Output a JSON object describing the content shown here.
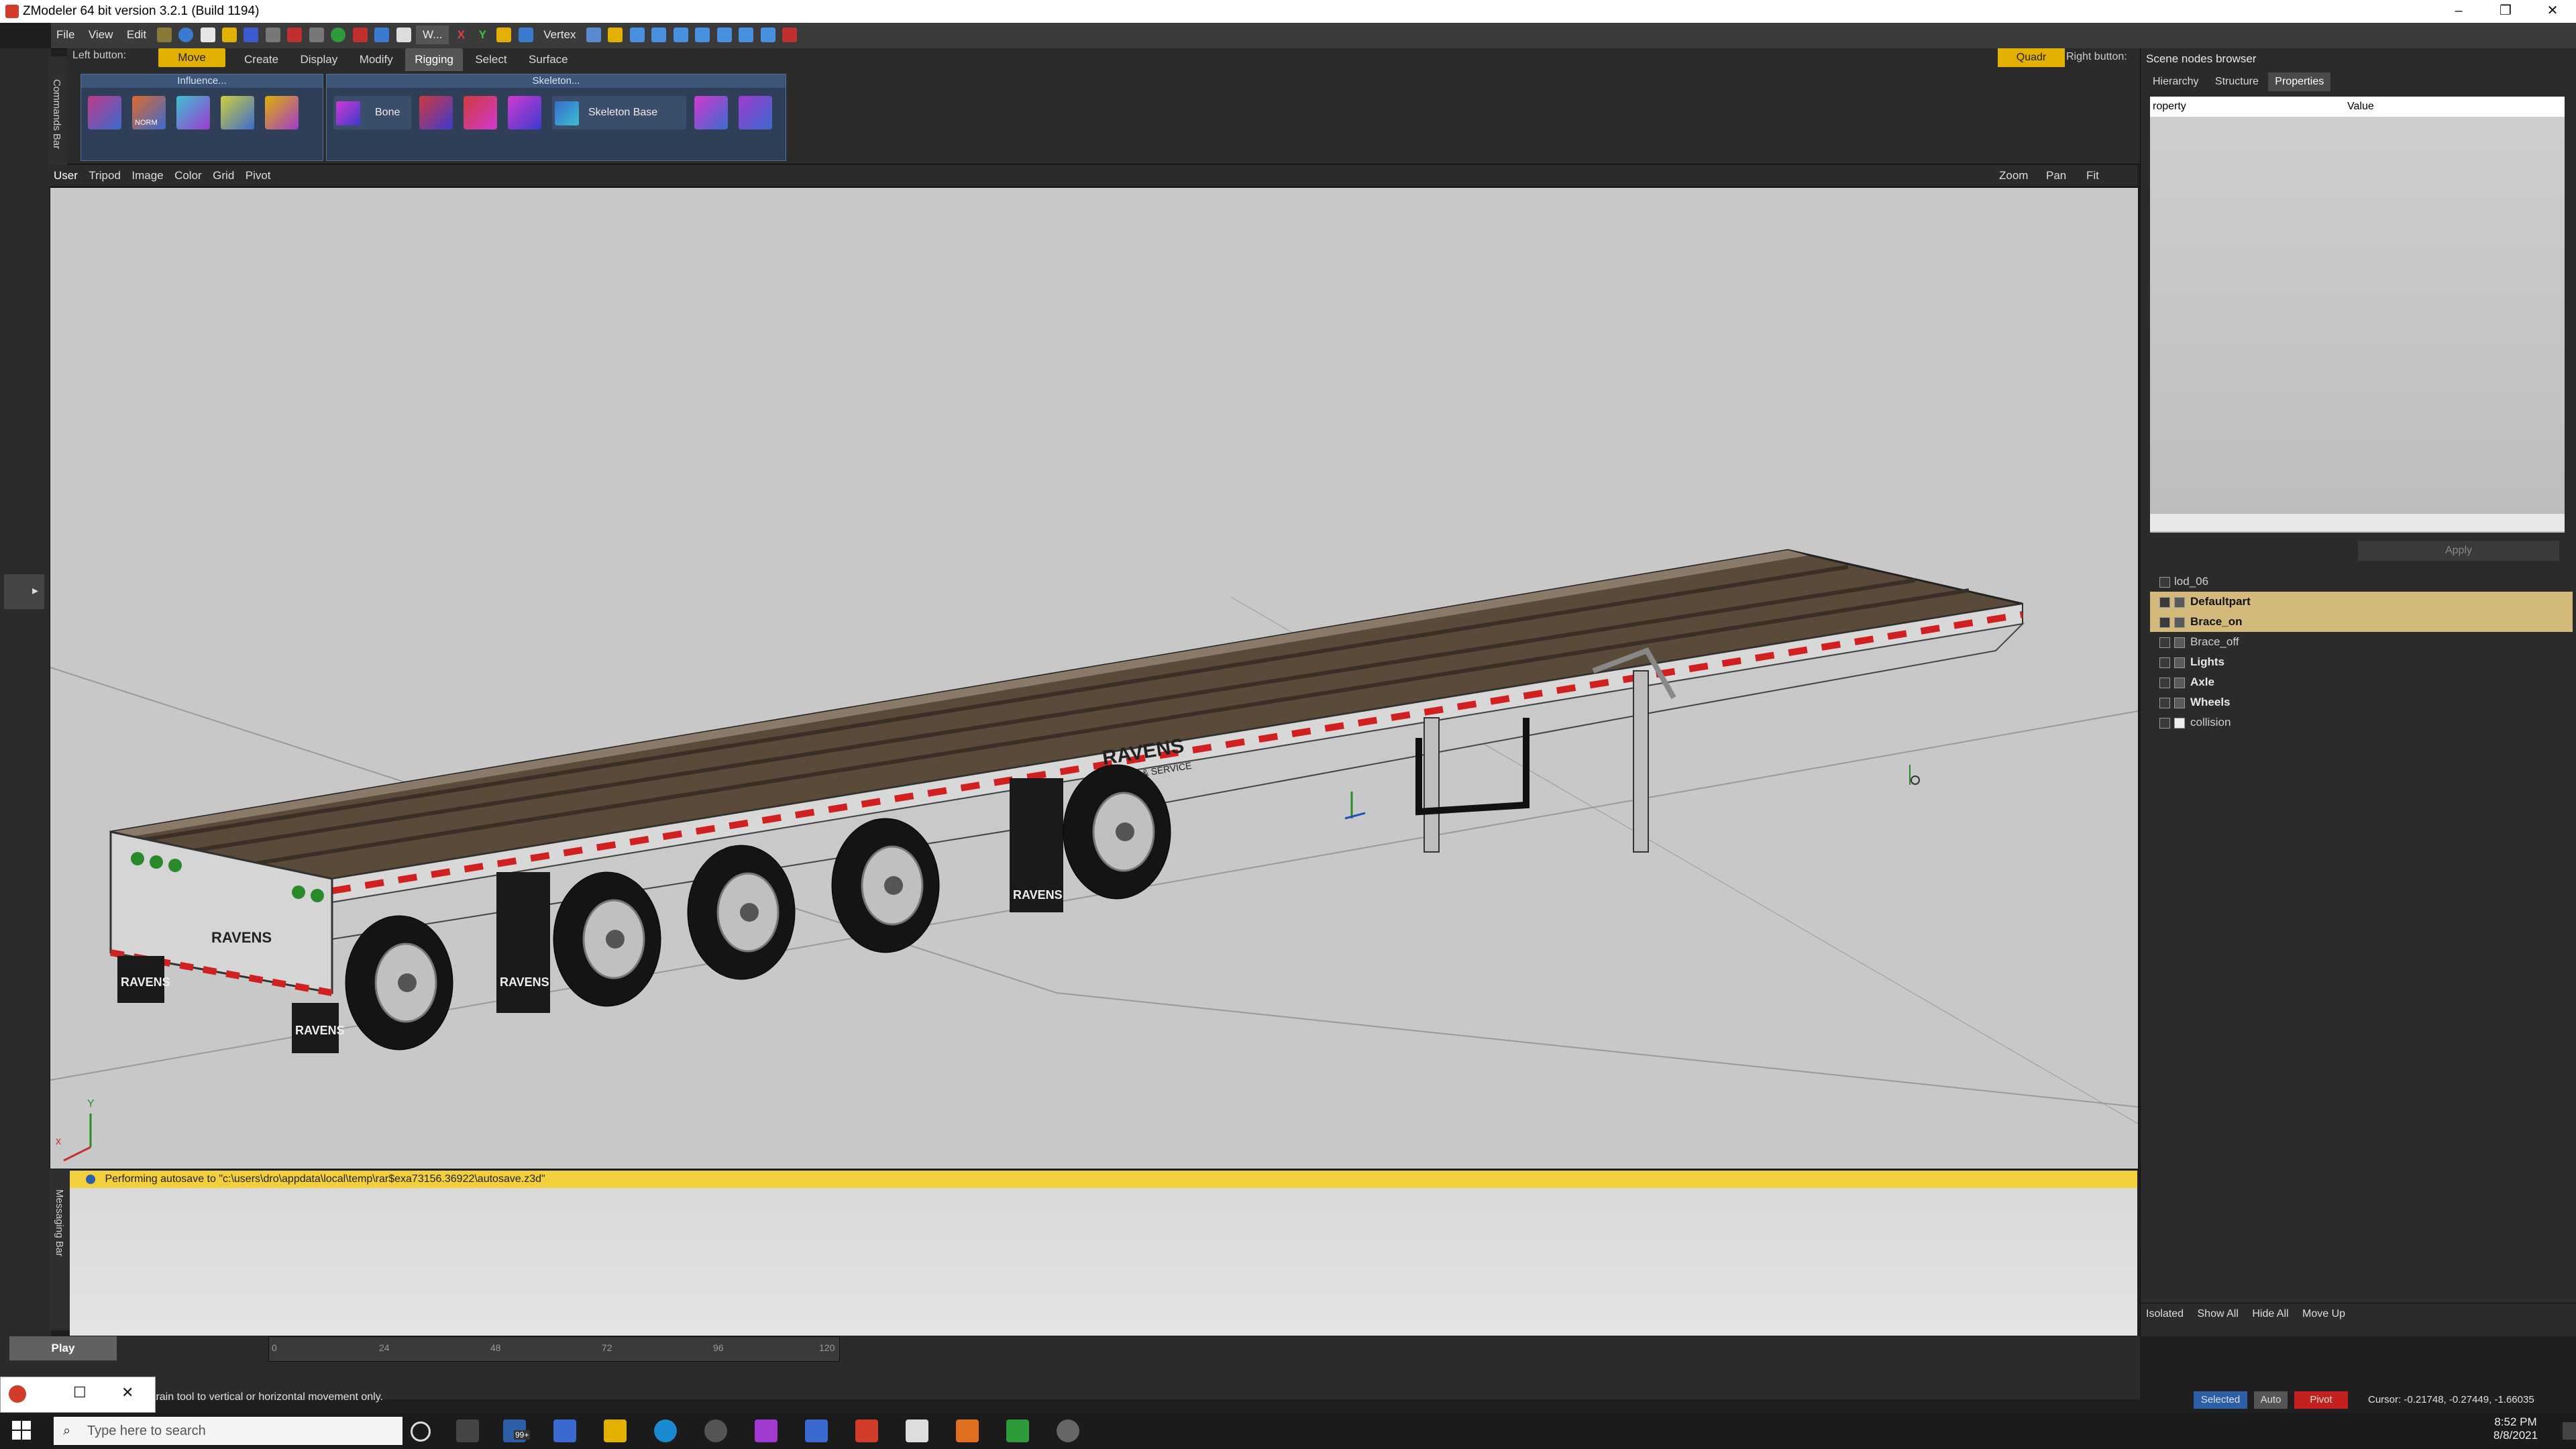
{
  "window": {
    "title": "ZModeler 64 bit version 3.2.1 (Build 1194)",
    "controls": {
      "minimize": "–",
      "restore": "❐",
      "close": "✕"
    }
  },
  "menu": {
    "items": [
      "File",
      "View",
      "Edit"
    ],
    "mode_label": "W...",
    "axis_x": "X",
    "axis_y": "Y",
    "selection_mode": "Vertex"
  },
  "command_panel": {
    "label": "Commands Bar",
    "left_button_label": "Left button:",
    "move_label": "Move",
    "tabs": [
      "Create",
      "Display",
      "Modify",
      "Rigging",
      "Select",
      "Surface"
    ],
    "active_tab": "Rigging",
    "influence_group_title": "Influence...",
    "skeleton_group_title": "Skeleton...",
    "norm_label": "NORM",
    "bone_label": "Bone",
    "skeleton_base_label": "Skeleton Base",
    "quadr_label": "Quadr",
    "right_button_label": "Right button:"
  },
  "viewport": {
    "header": [
      "User",
      "Tripod",
      "Image",
      "Color",
      "Grid",
      "Pivot"
    ],
    "zoom_label": "Zoom",
    "pan_label": "Pan",
    "fit_label": "Fit",
    "axis_y_label": "Y",
    "axis_x_label": "x",
    "brand_text": "RAVENS",
    "brand_sub": "SALES & SERVICE"
  },
  "messaging": {
    "label": "Messaging Bar",
    "message": "Performing autosave to \"c:\\users\\dro\\appdata\\local\\temp\\rar$exa73156.36922\\autosave.z3d\""
  },
  "scene_browser": {
    "title": "Scene nodes browser",
    "tabs": [
      "Hierarchy",
      "Structure",
      "Properties"
    ],
    "active_tab": "Properties",
    "property_header": "roperty",
    "value_header": "Value",
    "apply_label": "Apply",
    "tree": [
      {
        "label": "lod_06",
        "bold": false,
        "selected": false
      },
      {
        "label": "Defaultpart",
        "bold": true,
        "selected": true
      },
      {
        "label": "Brace_on",
        "bold": true,
        "selected": true
      },
      {
        "label": "Brace_off",
        "bold": false,
        "selected": false
      },
      {
        "label": "Lights",
        "bold": true,
        "selected": false
      },
      {
        "label": "Axle",
        "bold": true,
        "selected": false
      },
      {
        "label": "Wheels",
        "bold": true,
        "selected": false
      },
      {
        "label": "collision",
        "bold": false,
        "selected": false
      }
    ],
    "bottom": [
      "Isolated",
      "Show All",
      "Hide All",
      "Move Up"
    ]
  },
  "timeline": {
    "play_label": "Play",
    "ticks": [
      "0",
      "24",
      "48",
      "72",
      "96",
      "120"
    ],
    "hint": "strain tool to vertical or horizontal movement only."
  },
  "status": {
    "selected": "Selected",
    "auto": "Auto",
    "pivot": "Pivot",
    "cursor": "Cursor: -0.21748, -0.27449, -1.66035"
  },
  "taskbar": {
    "search_placeholder": "Type here to search",
    "mail_badge": "99+",
    "time": "8:52 PM",
    "date": "8/8/2021"
  },
  "colors": {
    "accent_yellow": "#e2b000",
    "selection_blue": "#2d5fa8",
    "pivot_red": "#c32020",
    "tree_selected": "#d3ba7a"
  }
}
